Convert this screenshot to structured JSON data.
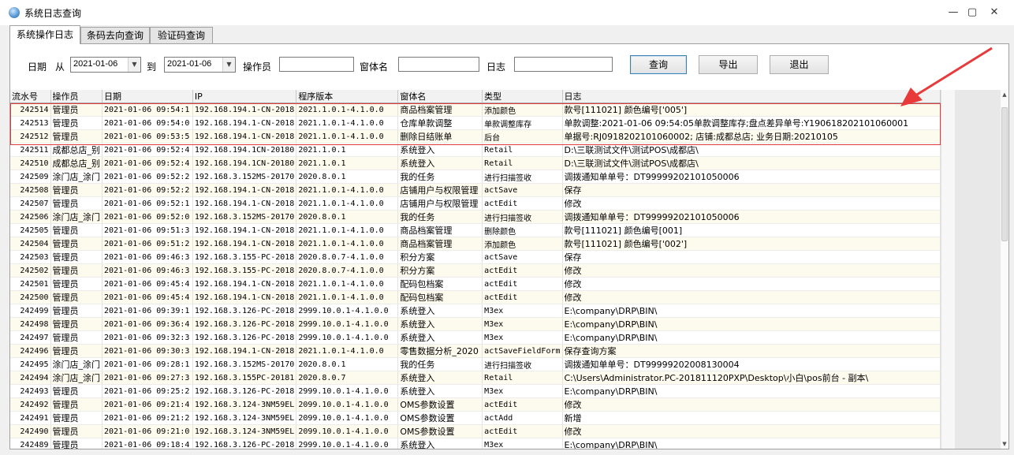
{
  "window": {
    "title": "系统日志查询"
  },
  "tabs": [
    "系统操作日志",
    "条码去向查询",
    "验证码查询"
  ],
  "filters": {
    "date_label": "日期",
    "from_label": "从",
    "from_value": "2021-01-06",
    "to_label": "到",
    "to_value": "2021-01-06",
    "operator_label": "操作员",
    "operator_value": "",
    "form_label": "窗体名",
    "form_value": "",
    "log_label": "日志",
    "log_value": ""
  },
  "buttons": {
    "query": "查询",
    "export": "导出",
    "exit": "退出"
  },
  "table": {
    "columns": [
      "流水号",
      "操作员",
      "日期",
      "IP",
      "程序版本",
      "窗体名",
      "类型",
      "日志"
    ],
    "rows": [
      [
        "242514",
        "管理员",
        "2021-01-06 09:54:1",
        "192.168.194.1-CN-2018",
        "2021.1.0.1-4.1.0.0",
        "商品档案管理",
        "添加颜色",
        "款号[111021] 颜色编号['005']"
      ],
      [
        "242513",
        "管理员",
        "2021-01-06 09:54:0",
        "192.168.194.1-CN-2018",
        "2021.1.0.1-4.1.0.0",
        "仓库单款调整",
        "单款调整库存",
        "单款调整:2021-01-06 09:54:05单款调整库存;盘点差异单号:Y190618202101060001"
      ],
      [
        "242512",
        "管理员",
        "2021-01-06 09:53:5",
        "192.168.194.1-CN-2018",
        "2021.1.0.1-4.1.0.0",
        "删除日结账单",
        "后台",
        "单据号:RJ0918202101060002; 店铺:成都总店; 业务日期:20210105"
      ],
      [
        "242511",
        "成都总店_别",
        "2021-01-06 09:52:4",
        "192.168.194.1CN-20180",
        "2021.1.0.1",
        "系统登入",
        "Retail",
        "D:\\三联测试文件\\测试POS\\成都店\\"
      ],
      [
        "242510",
        "成都总店_别",
        "2021-01-06 09:52:4",
        "192.168.194.1CN-20180",
        "2021.1.0.1",
        "系统登入",
        "Retail",
        "D:\\三联测试文件\\测试POS\\成都店\\"
      ],
      [
        "242509",
        "涂门店_涂门",
        "2021-01-06 09:52:2",
        "192.168.3.152MS-20170",
        "2020.8.0.1",
        "我的任务",
        "进行扫描签收",
        "调拨通知单单号：DT99999202101050006"
      ],
      [
        "242508",
        "管理员",
        "2021-01-06 09:52:2",
        "192.168.194.1-CN-2018",
        "2021.1.0.1-4.1.0.0",
        "店铺用户与权限管理",
        "actSave",
        "保存"
      ],
      [
        "242507",
        "管理员",
        "2021-01-06 09:52:1",
        "192.168.194.1-CN-2018",
        "2021.1.0.1-4.1.0.0",
        "店铺用户与权限管理",
        "actEdit",
        "修改"
      ],
      [
        "242506",
        "涂门店_涂门",
        "2021-01-06 09:52:0",
        "192.168.3.152MS-20170",
        "2020.8.0.1",
        "我的任务",
        "进行扫描签收",
        "调拨通知单单号：DT99999202101050006"
      ],
      [
        "242505",
        "管理员",
        "2021-01-06 09:51:3",
        "192.168.194.1-CN-2018",
        "2021.1.0.1-4.1.0.0",
        "商品档案管理",
        "删除颜色",
        "款号[111021] 颜色编号[001]"
      ],
      [
        "242504",
        "管理员",
        "2021-01-06 09:51:2",
        "192.168.194.1-CN-2018",
        "2021.1.0.1-4.1.0.0",
        "商品档案管理",
        "添加颜色",
        "款号[111021] 颜色编号['002']"
      ],
      [
        "242503",
        "管理员",
        "2021-01-06 09:46:3",
        "192.168.3.155-PC-2018",
        "2020.8.0.7-4.1.0.0",
        "积分方案",
        "actSave",
        "保存"
      ],
      [
        "242502",
        "管理员",
        "2021-01-06 09:46:3",
        "192.168.3.155-PC-2018",
        "2020.8.0.7-4.1.0.0",
        "积分方案",
        "actEdit",
        "修改"
      ],
      [
        "242501",
        "管理员",
        "2021-01-06 09:45:4",
        "192.168.194.1-CN-2018",
        "2021.1.0.1-4.1.0.0",
        "配码包档案",
        "actEdit",
        "修改"
      ],
      [
        "242500",
        "管理员",
        "2021-01-06 09:45:4",
        "192.168.194.1-CN-2018",
        "2021.1.0.1-4.1.0.0",
        "配码包档案",
        "actEdit",
        "修改"
      ],
      [
        "242499",
        "管理员",
        "2021-01-06 09:39:1",
        "192.168.3.126-PC-2018",
        "2999.10.0.1-4.1.0.0",
        "系统登入",
        "M3ex",
        "E:\\company\\DRP\\BIN\\"
      ],
      [
        "242498",
        "管理员",
        "2021-01-06 09:36:4",
        "192.168.3.126-PC-2018",
        "2999.10.0.1-4.1.0.0",
        "系统登入",
        "M3ex",
        "E:\\company\\DRP\\BIN\\"
      ],
      [
        "242497",
        "管理员",
        "2021-01-06 09:32:3",
        "192.168.3.126-PC-2018",
        "2999.10.0.1-4.1.0.0",
        "系统登入",
        "M3ex",
        "E:\\company\\DRP\\BIN\\"
      ],
      [
        "242496",
        "管理员",
        "2021-01-06 09:30:3",
        "192.168.194.1-CN-2018",
        "2021.1.0.1-4.1.0.0",
        "零售数据分析_2020",
        "actSaveFieldForm",
        "保存查询方案"
      ],
      [
        "242495",
        "涂门店_涂门",
        "2021-01-06 09:28:1",
        "192.168.3.152MS-20170",
        "2020.8.0.1",
        "我的任务",
        "进行扫描签收",
        "调拨通知单单号：DT99999202008130004"
      ],
      [
        "242494",
        "涂门店_涂门",
        "2021-01-06 09:27:3",
        "192.168.3.155PC-20181",
        "2020.8.0.7",
        "系统登入",
        "Retail",
        "C:\\Users\\Administrator.PC-201811120PXP\\Desktop\\小白\\pos前台 - 副本\\"
      ],
      [
        "242493",
        "管理员",
        "2021-01-06 09:25:2",
        "192.168.3.126-PC-2018",
        "2999.10.0.1-4.1.0.0",
        "系统登入",
        "M3ex",
        "E:\\company\\DRP\\BIN\\"
      ],
      [
        "242492",
        "管理员",
        "2021-01-06 09:21:4",
        "192.168.3.124-3NM59EL",
        "2099.10.0.1-4.1.0.0",
        "OMS参数设置",
        "actEdit",
        "修改"
      ],
      [
        "242491",
        "管理员",
        "2021-01-06 09:21:2",
        "192.168.3.124-3NM59EL",
        "2099.10.0.1-4.1.0.0",
        "OMS参数设置",
        "actAdd",
        "新增"
      ],
      [
        "242490",
        "管理员",
        "2021-01-06 09:21:0",
        "192.168.3.124-3NM59EL",
        "2099.10.0.1-4.1.0.0",
        "OMS参数设置",
        "actEdit",
        "修改"
      ],
      [
        "242489",
        "管理员",
        "2021-01-06 09:18:4",
        "192.168.3.126-PC-2018",
        "2999.10.0.1-4.1.0.0",
        "系统登入",
        "M3ex",
        "E:\\company\\DRP\\BIN\\"
      ]
    ]
  },
  "colors": {
    "highlight": "#e23b3b",
    "row_alt": "#fdfbee"
  }
}
